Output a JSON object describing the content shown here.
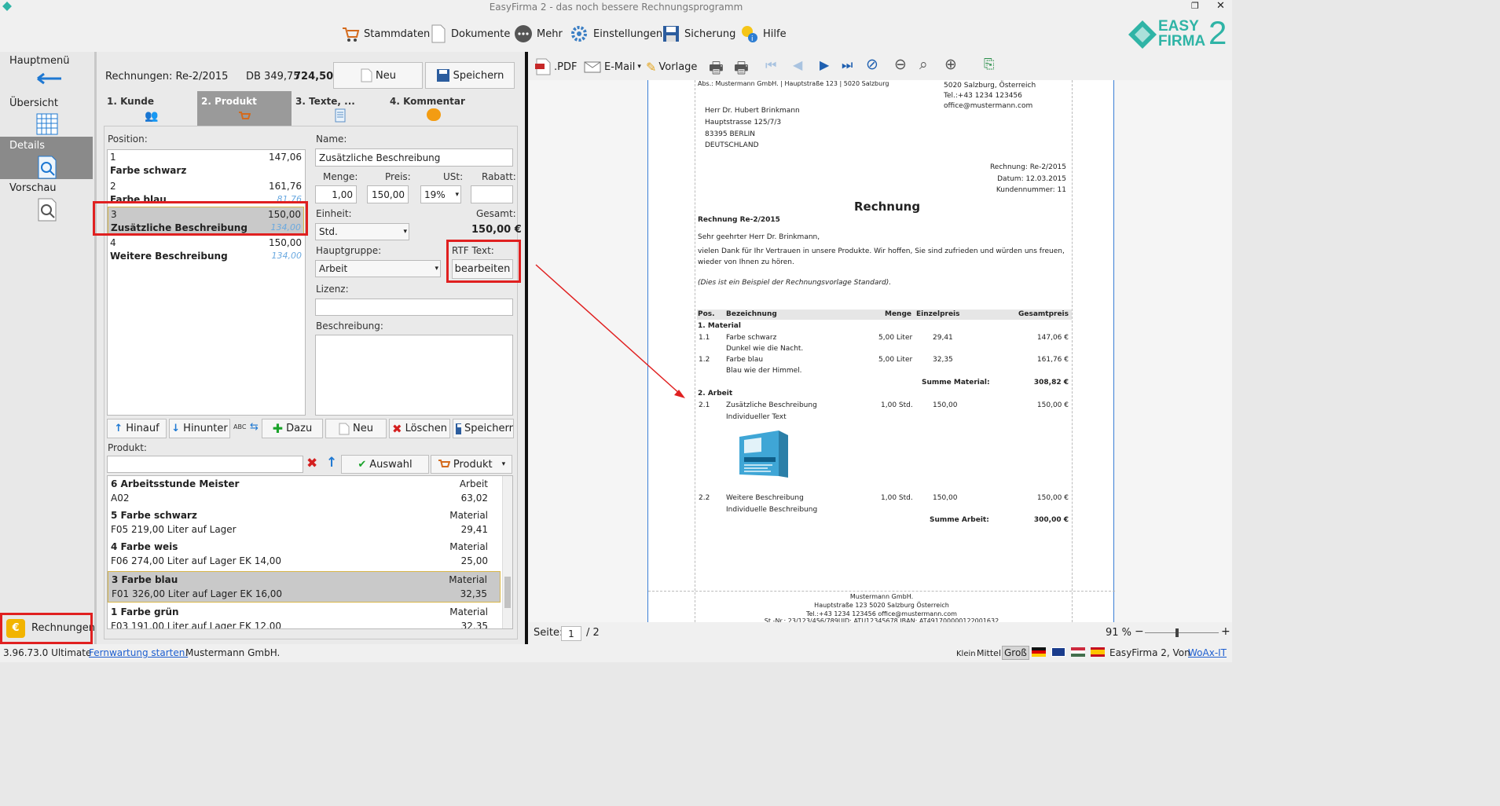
{
  "app": {
    "title": "EasyFirma 2 - das noch bessere Rechnungsprogramm"
  },
  "toolbar": {
    "items": [
      "Stammdaten",
      "Dokumente",
      "Mehr",
      "Einstellungen",
      "Sicherung",
      "Hilfe"
    ]
  },
  "logo": {
    "line1": "EASY",
    "line2": "FIRMA",
    "num": "2"
  },
  "sidebar": {
    "items": [
      "Hauptmenü",
      "Übersicht",
      "Details",
      "Vorschau"
    ],
    "bottom": "Rechnungen"
  },
  "header": {
    "doc": "Rechnungen: Re-2/2015",
    "db": "DB 349,75",
    "total": "724,50",
    "new": "Neu",
    "save": "Speichern"
  },
  "tabs": [
    "1. Kunde",
    "2. Produkt",
    "3. Texte, ...",
    "4. Kommentar"
  ],
  "positions": {
    "label": "Position:",
    "rows": [
      {
        "n": "1",
        "v": "147,06",
        "d": "Farbe schwarz",
        "i": ""
      },
      {
        "n": "2",
        "v": "161,76",
        "d": "Farbe blau",
        "i": "81,76"
      },
      {
        "n": "3",
        "v": "150,00",
        "d": "Zusätzliche Beschreibung",
        "i": "134,00"
      },
      {
        "n": "4",
        "v": "150,00",
        "d": "Weitere Beschreibung",
        "i": "134,00"
      }
    ]
  },
  "form": {
    "name_label": "Name:",
    "name": "Zusätzliche Beschreibung",
    "menge_label": "Menge:",
    "menge": "1,00",
    "preis_label": "Preis:",
    "preis": "150,00",
    "ust_label": "USt:",
    "ust": "19%",
    "rabatt_label": "Rabatt:",
    "rabatt": "",
    "einheit_label": "Einheit:",
    "einheit": "Std.",
    "gesamt_label": "Gesamt:",
    "gesamt": "150,00 €",
    "hauptgruppe_label": "Hauptgruppe:",
    "hauptgruppe": "Arbeit",
    "rtf_label": "RTF Text:",
    "rtf_btn": "bearbeiten",
    "lizenz_label": "Lizenz:",
    "beschreibung_label": "Beschreibung:"
  },
  "actions": {
    "up": "Hinauf",
    "down": "Hinunter",
    "abc": "ABC",
    "add": "Dazu",
    "new": "Neu",
    "delete": "Löschen",
    "save": "Speicherr"
  },
  "produkt": {
    "label": "Produkt:",
    "auswahl": "Auswahl",
    "produkt": "Produkt",
    "rows": [
      {
        "t": "6 Arbeitsstunde Meister",
        "c": "Arbeit",
        "s": "A02",
        "p": "63,02"
      },
      {
        "t": "5 Farbe schwarz",
        "c": "Material",
        "s": "F05 219,00 Liter auf Lager",
        "p": "29,41"
      },
      {
        "t": "4 Farbe weis",
        "c": "Material",
        "s": "F06 274,00 Liter auf Lager EK 14,00",
        "p": "25,00"
      },
      {
        "t": "3 Farbe blau",
        "c": "Material",
        "s": "F01 326,00 Liter auf Lager EK 16,00",
        "p": "32,35"
      },
      {
        "t": "1 Farbe grün",
        "c": "Material",
        "s": "F03 191,00 Liter auf Lager EK 12,00",
        "p": "32,35"
      }
    ]
  },
  "preview_toolbar": {
    "pdf": ".PDF",
    "email": "E-Mail",
    "vorlage": "Vorlage"
  },
  "invoice": {
    "sender_line": "Abs.: Mustermann GmbH. | Hauptstraße 123 | 5020 Salzburg",
    "sender_addr": [
      "5020 Salzburg, Österreich",
      "Tel.:+43 1234 123456",
      "office@mustermann.com"
    ],
    "recipient": [
      "Herr Dr. Hubert Brinkmann",
      "Hauptstrasse 125/7/3",
      "83395 BERLIN",
      "DEUTSCHLAND"
    ],
    "meta": [
      "Rechnung: Re-2/2015",
      "Datum: 12.03.2015",
      "Kundennummer: 11"
    ],
    "title": "Rechnung",
    "subject": "Rechnung Re-2/2015",
    "greeting": "Sehr geehrter Herr Dr. Brinkmann,",
    "intro1": "vielen Dank für Ihr Vertrauen in unsere Produkte. Wir hoffen, Sie sind zufrieden und würden uns freuen,",
    "intro2": "wieder von Ihnen zu hören.",
    "note": "(Dies ist ein Beispiel der Rechnungsvorlage Standard).",
    "head": [
      "Pos.",
      "Bezeichnung",
      "Menge",
      "Einzelpreis",
      "Gesamtpreis"
    ],
    "g1": "1. Material",
    "l1": [
      "1.1",
      "Farbe schwarz",
      "5,00 Liter",
      "29,41",
      "147,06 €"
    ],
    "l1d": "Dunkel wie die Nacht.",
    "l2": [
      "1.2",
      "Farbe blau",
      "5,00 Liter",
      "32,35",
      "161,76 €"
    ],
    "l2d": "Blau wie der Himmel.",
    "s1": "Summe Material:",
    "s1v": "308,82 €",
    "g2": "2. Arbeit",
    "l3": [
      "2.1",
      "Zusätzliche Beschreibung",
      "1,00 Std.",
      "150,00",
      "150,00 €"
    ],
    "l3d": "Individueller Text",
    "l4": [
      "2.2",
      "Weitere Beschreibung",
      "1,00 Std.",
      "150,00",
      "150,00 €"
    ],
    "l4d": "Individuelle Beschreibung",
    "s2": "Summe Arbeit:",
    "s2v": "300,00 €",
    "footer": [
      "Mustermann GmbH.",
      "Hauptstraße 123  5020 Salzburg Österreich",
      "Tel.:+43  1234 123456  office@mustermann.com",
      "St.-Nr.: 23/123/456/789UID: ATU12345678 IBAN: AT491700000122001632"
    ]
  },
  "pagebar": {
    "label": "Seite:",
    "page": "1",
    "of": "/ 2",
    "zoom": "91 %"
  },
  "status": {
    "version": "3.96.73.0 Ultimate",
    "remote": "Fernwartung starten.",
    "company": "Mustermann GmbH.",
    "sizes": [
      "Klein",
      "Mittel",
      "Groß"
    ],
    "credit": "EasyFirma 2, Von",
    "vendor": "WoAx-IT"
  }
}
